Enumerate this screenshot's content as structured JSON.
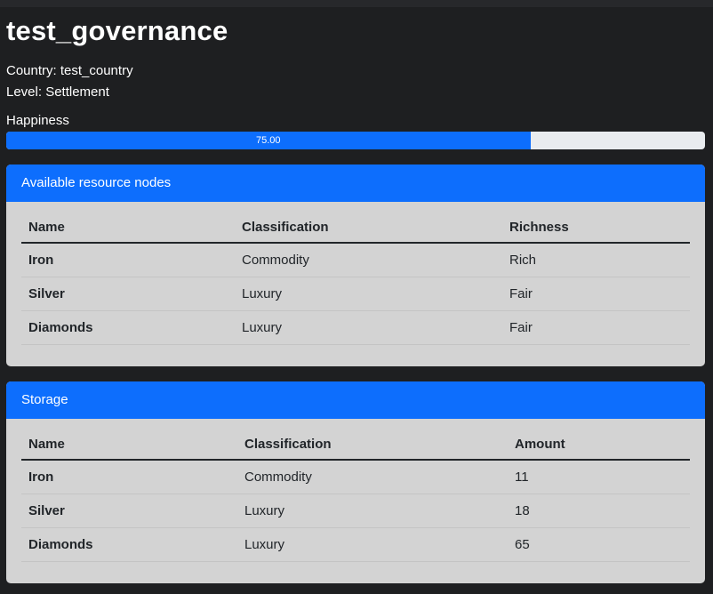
{
  "page": {
    "title": "test_governance",
    "country": "Country: test_country",
    "level": "Level: Settlement"
  },
  "happiness": {
    "label": "Happiness",
    "value": 75,
    "value_text": "75.00",
    "max": 100
  },
  "resources": {
    "header": "Available resource nodes",
    "columns": [
      "Name",
      "Classification",
      "Richness"
    ],
    "rows": [
      {
        "name": "Iron",
        "classification": "Commodity",
        "richness": "Rich"
      },
      {
        "name": "Silver",
        "classification": "Luxury",
        "richness": "Fair"
      },
      {
        "name": "Diamonds",
        "classification": "Luxury",
        "richness": "Fair"
      }
    ]
  },
  "storage": {
    "header": "Storage",
    "columns": [
      "Name",
      "Classification",
      "Amount"
    ],
    "rows": [
      {
        "name": "Iron",
        "classification": "Commodity",
        "amount": "11"
      },
      {
        "name": "Silver",
        "classification": "Luxury",
        "amount": "18"
      },
      {
        "name": "Diamonds",
        "classification": "Luxury",
        "amount": "65"
      }
    ]
  },
  "colors": {
    "background": "#1e1f21",
    "accent": "#0d6efd",
    "card": "#d3d3d3",
    "progress_track": "#e9ecef"
  }
}
